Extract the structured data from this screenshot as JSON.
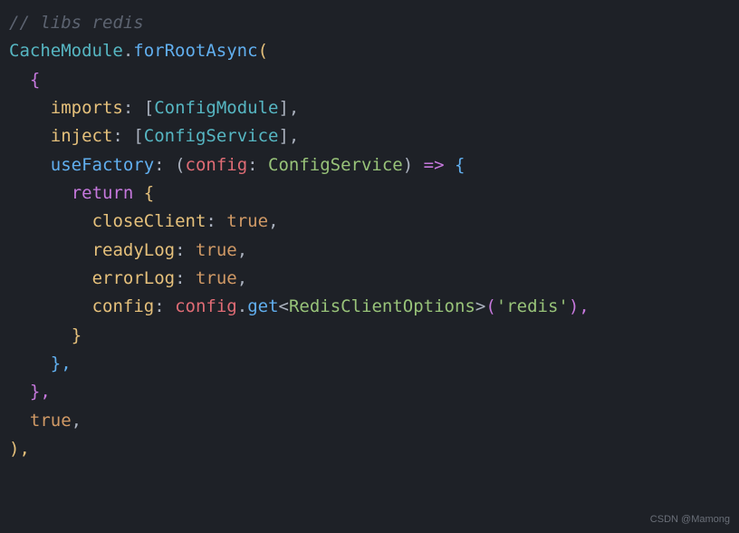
{
  "code": {
    "line1_comment": "// libs redis",
    "line2_class": "CacheModule",
    "line2_dot": ".",
    "line2_method": "forRootAsync",
    "line2_open": "(",
    "line3_brace": "{",
    "line4_prop": "imports",
    "line4_colon": ": [",
    "line4_val": "ConfigModule",
    "line4_end": "],",
    "line5_prop": "inject",
    "line5_colon": ": [",
    "line5_val": "ConfigService",
    "line5_end": "],",
    "line6_prop": "useFactory",
    "line6_colon": ": (",
    "line6_param": "config",
    "line6_ptype_sep": ": ",
    "line6_ptype": "ConfigService",
    "line6_arrow_pre": ") ",
    "line6_arrow": "=>",
    "line6_arrow_post": " ",
    "line6_brace": "{",
    "line7_return": "return",
    "line7_brace": " {",
    "line8_prop": "closeClient",
    "line8_sep": ": ",
    "line8_val": "true",
    "line8_end": ",",
    "line9_prop": "readyLog",
    "line9_sep": ": ",
    "line9_val": "true",
    "line9_end": ",",
    "line10_prop": "errorLog",
    "line10_sep": ": ",
    "line10_val": "true",
    "line10_end": ",",
    "line11_prop": "config",
    "line11_sep": ": ",
    "line11_obj": "config",
    "line11_dot": ".",
    "line11_method": "get",
    "line11_lt": "<",
    "line11_generic": "RedisClientOptions",
    "line11_gt": ">",
    "line11_open": "(",
    "line11_str": "'redis'",
    "line11_close": "),",
    "line12_brace": "}",
    "line13_brace": "},",
    "line14_brace": "},",
    "line15_val": "true",
    "line15_end": ",",
    "line16_close": "),"
  },
  "watermark": "CSDN @Mamong"
}
